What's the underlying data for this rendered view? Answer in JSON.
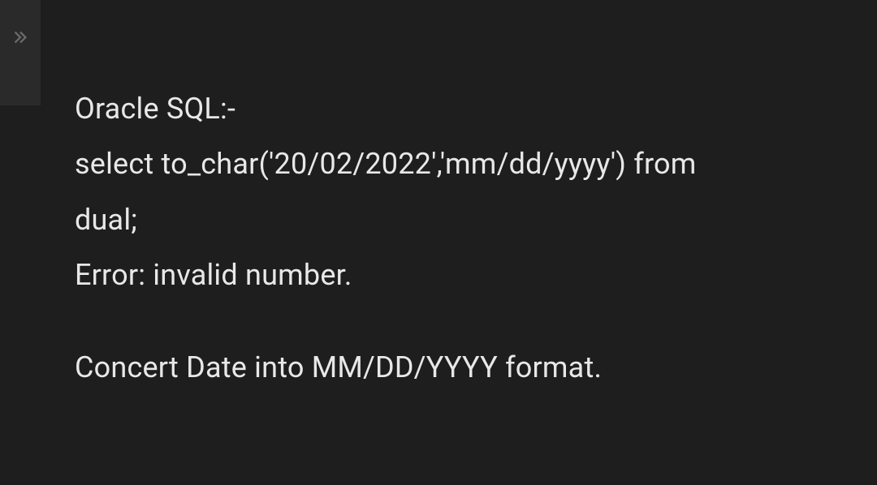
{
  "content": {
    "lines": [
      "Oracle SQL:-",
      "select to_char('20/02/2022','mm/dd/yyyy') from",
      "dual;",
      "Error: invalid number."
    ],
    "footer": "Concert Date into MM/DD/YYYY format."
  }
}
